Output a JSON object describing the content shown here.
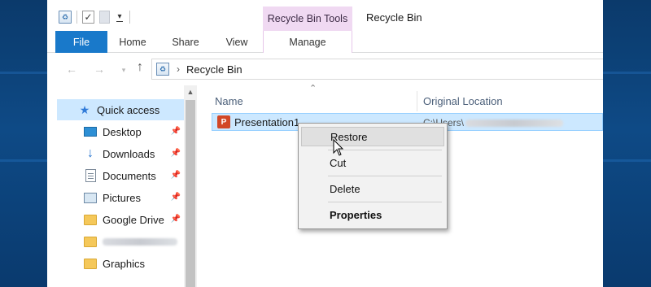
{
  "window": {
    "title": "Recycle Bin",
    "contextual_tab_header": "Recycle Bin Tools"
  },
  "ribbon": {
    "tabs": [
      {
        "label": "File"
      },
      {
        "label": "Home"
      },
      {
        "label": "Share"
      },
      {
        "label": "View"
      },
      {
        "label": "Manage"
      }
    ]
  },
  "address": {
    "path": "Recycle Bin",
    "separator": "›"
  },
  "navpane": {
    "items": [
      {
        "label": "Quick access",
        "icon": "star-icon",
        "selected": true,
        "pinned": false
      },
      {
        "label": "Desktop",
        "icon": "desktop-icon",
        "pinned": true
      },
      {
        "label": "Downloads",
        "icon": "download-arrow-icon",
        "pinned": true
      },
      {
        "label": "Documents",
        "icon": "documents-icon",
        "pinned": true
      },
      {
        "label": "Pictures",
        "icon": "pictures-icon",
        "pinned": true
      },
      {
        "label": "Google Drive",
        "icon": "folder-icon",
        "pinned": true
      },
      {
        "label": "",
        "icon": "folder-icon",
        "pinned": false,
        "blurred": true
      },
      {
        "label": "Graphics",
        "icon": "folder-icon",
        "pinned": false
      }
    ]
  },
  "filelist": {
    "columns": [
      {
        "label": "Name"
      },
      {
        "label": "Original Location"
      }
    ],
    "rows": [
      {
        "name": "Presentation1",
        "location_prefix": "C:\\Users\\",
        "icon": "powerpoint-icon",
        "selected": true
      }
    ]
  },
  "context_menu": {
    "items": [
      {
        "label": "Restore",
        "hover": true
      },
      {
        "label": "Cut"
      },
      {
        "label": "Delete"
      },
      {
        "label": "Properties",
        "bold": true
      }
    ]
  },
  "colors": {
    "file_tab": "#1979ca",
    "contextual_tab": "#f0d9f2",
    "selection": "#cde8ff",
    "desktop_bg": "#0e4a86"
  }
}
